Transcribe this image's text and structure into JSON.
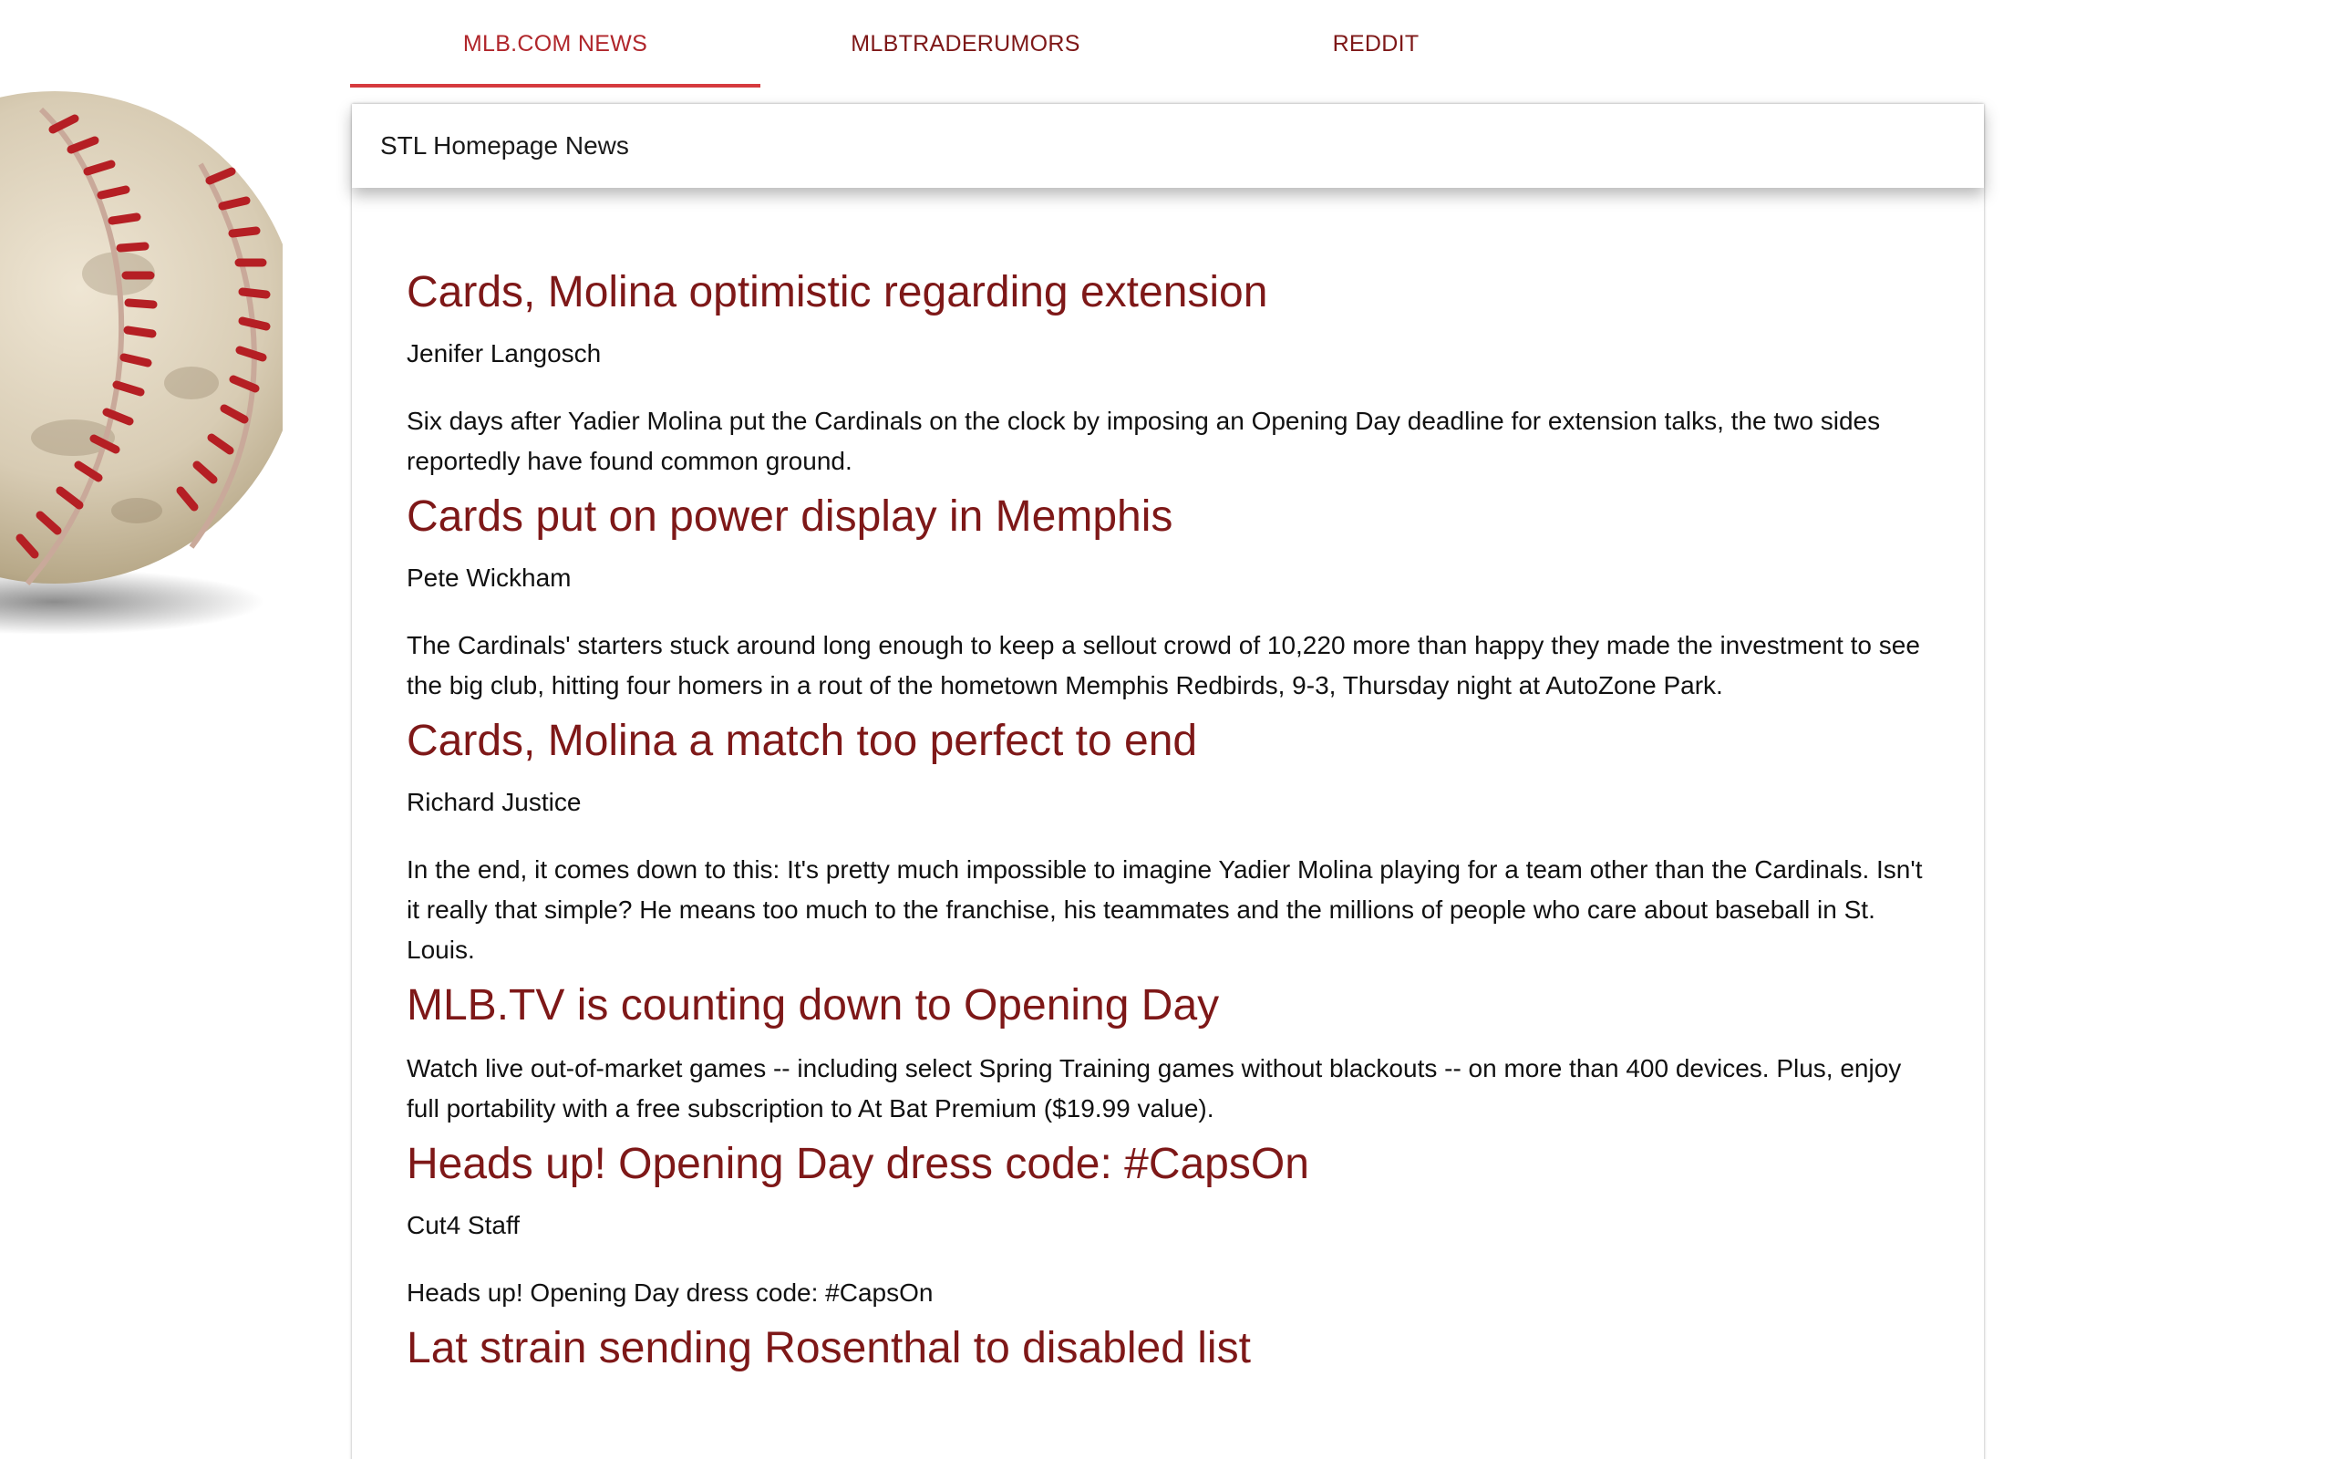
{
  "tabs": [
    {
      "label": "MLB.COM NEWS",
      "active": true
    },
    {
      "label": "MLBTRADERUMORS",
      "active": false
    },
    {
      "label": "REDDIT",
      "active": false
    }
  ],
  "card": {
    "header": "STL Homepage News"
  },
  "articles": [
    {
      "title": "Cards, Molina optimistic regarding extension",
      "author": "Jenifer Langosch",
      "summary": "Six days after Yadier Molina put the Cardinals on the clock by imposing an Opening Day deadline for extension talks, the two sides reportedly have found common ground."
    },
    {
      "title": "Cards put on power display in Memphis",
      "author": "Pete Wickham",
      "summary": "The Cardinals' starters stuck around long enough to keep a sellout crowd of 10,220 more than happy they made the investment to see the big club, hitting four homers in a rout of the hometown Memphis Redbirds, 9-3, Thursday night at AutoZone Park."
    },
    {
      "title": "Cards, Molina a match too perfect to end",
      "author": "Richard Justice",
      "summary": "In the end, it comes down to this: It's pretty much impossible to imagine Yadier Molina playing for a team other than the Cardinals. Isn't it really that simple? He means too much to the franchise, his teammates and the millions of people who care about baseball in St. Louis."
    },
    {
      "title": "MLB.TV is counting down to Opening Day",
      "author": "",
      "summary": "Watch live out-of-market games -- including select Spring Training games without blackouts -- on more than 400 devices. Plus, enjoy full portability with a free subscription to At Bat Premium ($19.99 value)."
    },
    {
      "title": "Heads up! Opening Day dress code: #CapsOn",
      "author": "Cut4 Staff",
      "summary": "Heads up! Opening Day dress code: #CapsOn"
    },
    {
      "title": "Lat strain sending Rosenthal to disabled list",
      "author": "",
      "summary": ""
    }
  ],
  "colors": {
    "tab_text": "#7e1818",
    "tab_active_text": "#b0262b",
    "tab_indicator": "#d63a3e",
    "headline": "#7e1818",
    "body_text": "#111111"
  },
  "decoration": {
    "background_icon": "baseball-icon"
  }
}
